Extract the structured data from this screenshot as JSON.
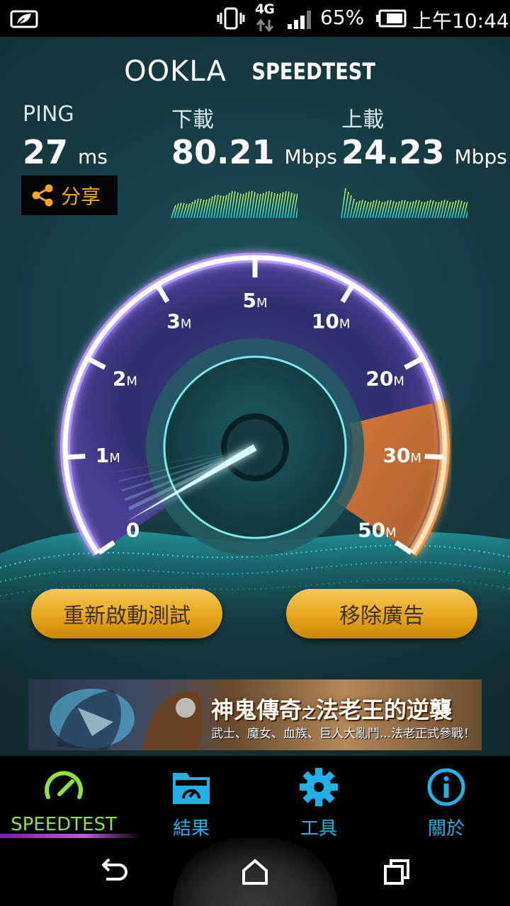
{
  "status_bar": {
    "network_type": "4G",
    "battery_percent": "65%",
    "time": "上午10:44",
    "icons": [
      "leaf-icon",
      "vibrate-icon",
      "data-arrows-icon",
      "signal-icon",
      "battery-icon"
    ]
  },
  "header": {
    "logo_ookla": "OOKLA",
    "logo_speedtest": "SPEEDTEST"
  },
  "results": {
    "ping_label": "PING",
    "ping_value": "27",
    "ping_unit": "ms",
    "download_label": "下載",
    "download_value": "80.21",
    "download_unit": "Mbps",
    "upload_label": "上載",
    "upload_value": "24.23",
    "upload_unit": "Mbps",
    "share_label": "分享"
  },
  "gauge": {
    "ticks": [
      {
        "value": "0",
        "unit": ""
      },
      {
        "value": "1",
        "unit": "M"
      },
      {
        "value": "2",
        "unit": "M"
      },
      {
        "value": "3",
        "unit": "M"
      },
      {
        "value": "5",
        "unit": "M"
      },
      {
        "value": "10",
        "unit": "M"
      },
      {
        "value": "20",
        "unit": "M"
      },
      {
        "value": "30",
        "unit": "M"
      },
      {
        "value": "50",
        "unit": "M"
      }
    ],
    "needle_reading_mbps": 0,
    "colors": {
      "arc": "#c8a6ff",
      "highlight": "#e89a44",
      "needle": "#bff4ff"
    }
  },
  "actions": {
    "restart_label": "重新啟動測試",
    "remove_ads_label": "移除廣告"
  },
  "ad": {
    "title": "神鬼傳奇之法老王的逆襲",
    "title_part1": "神鬼傳奇",
    "title_connector": "之",
    "title_part2": "法老王的逆襲",
    "subtitle": "武士、魔女、血族、巨人大亂鬥...法老正式參戰！"
  },
  "tabs": [
    {
      "label": "SPEEDTEST",
      "icon": "speedometer-icon",
      "active": true
    },
    {
      "label": "結果",
      "icon": "folder-gauge-icon",
      "active": false
    },
    {
      "label": "工具",
      "icon": "gear-icon",
      "active": false
    },
    {
      "label": "關於",
      "icon": "info-icon",
      "active": false
    }
  ],
  "colors": {
    "tab_active": "#8ee13a",
    "tab_inactive": "#1fb2e6",
    "button": "#f0b73a",
    "share": "#f5a623"
  }
}
